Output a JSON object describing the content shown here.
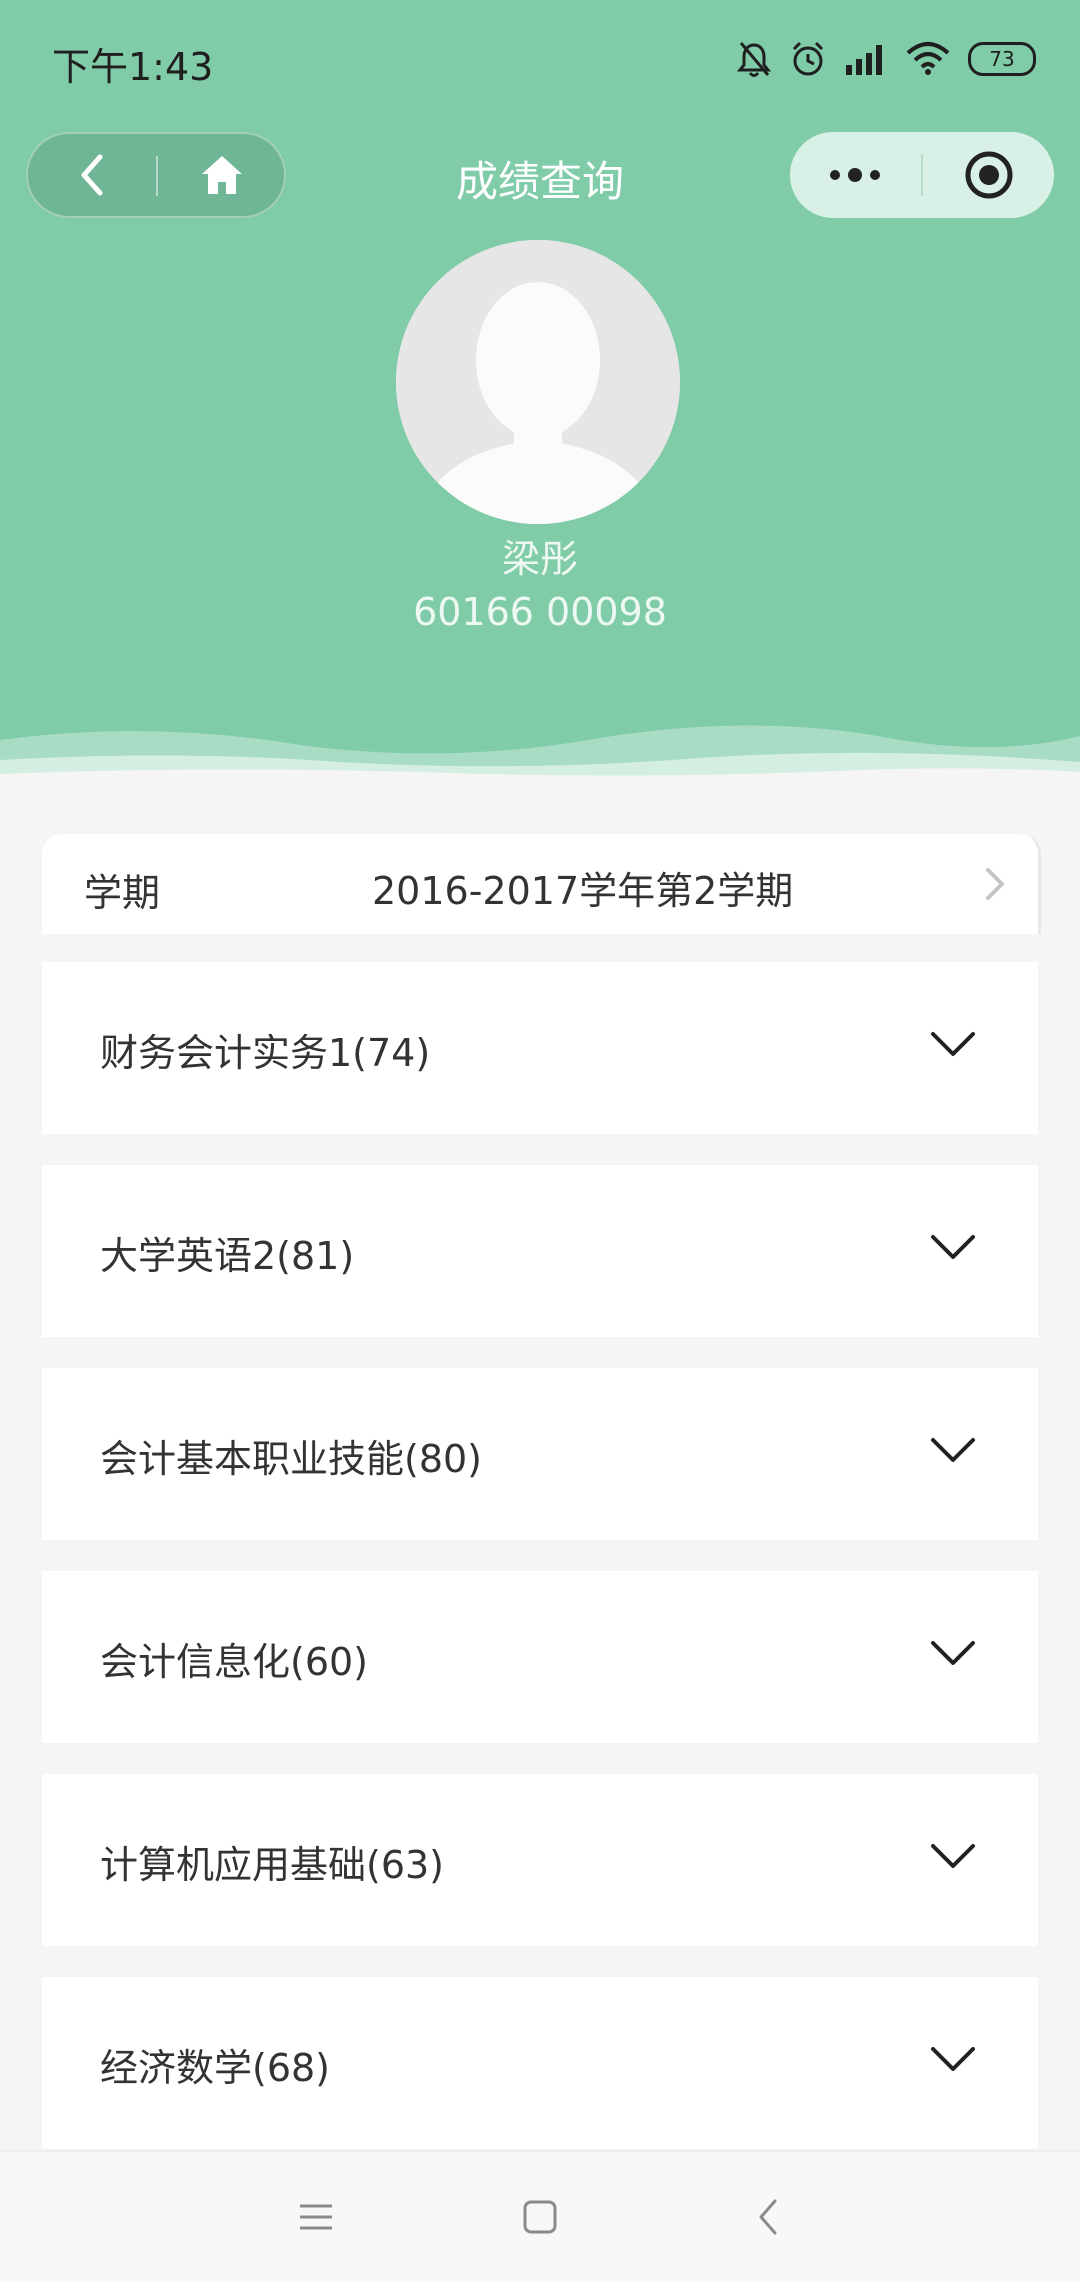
{
  "status_bar": {
    "time": "下午1:43",
    "battery": "73",
    "icons": [
      "bell-muted-icon",
      "alarm-icon",
      "signal-icon",
      "wifi-icon",
      "battery-icon"
    ]
  },
  "nav": {
    "title": "成绩查询",
    "back_icon": "back-arrow-icon",
    "home_icon": "home-icon",
    "more_icon": "more-dots-icon",
    "close_icon": "target-close-icon"
  },
  "profile": {
    "name": "梁彤",
    "student_id": "60166 00098"
  },
  "term": {
    "label": "学期",
    "value": "2016-2017学年第2学期"
  },
  "courses": [
    {
      "label": "财务会计实务1(74)"
    },
    {
      "label": "大学英语2(81)"
    },
    {
      "label": "会计基本职业技能(80)"
    },
    {
      "label": "会计信息化(60)"
    },
    {
      "label": "计算机应用基础(63)"
    },
    {
      "label": "经济数学(68)"
    }
  ],
  "colors": {
    "header_bg": "#80cca9",
    "page_bg": "#f5f5f5",
    "card_bg": "#ffffff",
    "text": "#333333"
  }
}
